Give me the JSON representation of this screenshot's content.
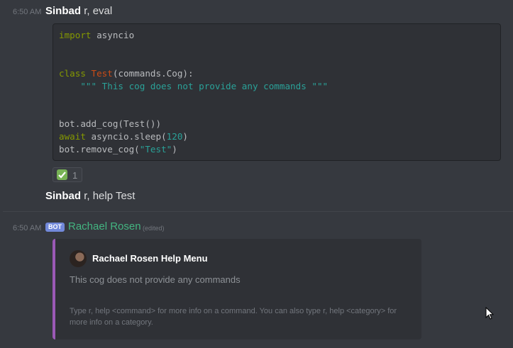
{
  "messages": {
    "first": {
      "timestamp": "6:50 AM",
      "author": "Sinbad",
      "text": "r, eval",
      "code": {
        "line1": {
          "kw": "import",
          "rest": " asyncio"
        },
        "line2": {
          "kw": "class",
          "cls": "Test",
          "rest": "(commands.Cog):"
        },
        "line3": {
          "str": "    \"\"\" This cog does not provide any commands \"\"\""
        },
        "line4": {
          "rest": "bot.add_cog(Test())"
        },
        "line5": {
          "kw": "await",
          "rest": " asyncio.sleep(",
          "num": "120",
          "end": ")"
        },
        "line6": {
          "rest": "bot.remove_cog(",
          "str": "\"Test\"",
          "end": ")"
        }
      },
      "reaction": {
        "icon": "white-check-mark",
        "count": "1"
      }
    },
    "second": {
      "author": "Sinbad",
      "text": "r, help Test"
    },
    "bot_message": {
      "timestamp": "6:50 AM",
      "bot_tag": "BOT",
      "author": "Rachael Rosen",
      "edited": "(edited)",
      "embed": {
        "accent_color": "#9b59b6",
        "author": "Rachael Rosen Help Menu",
        "description": "This cog does not provide any commands",
        "footer": "Type r, help <command> for more info on a command. You can also type r, help <category> for more info on a category."
      }
    }
  },
  "colors": {
    "background": "#36393f",
    "bot_name": "#43b581",
    "bot_tag": "#7289da"
  }
}
